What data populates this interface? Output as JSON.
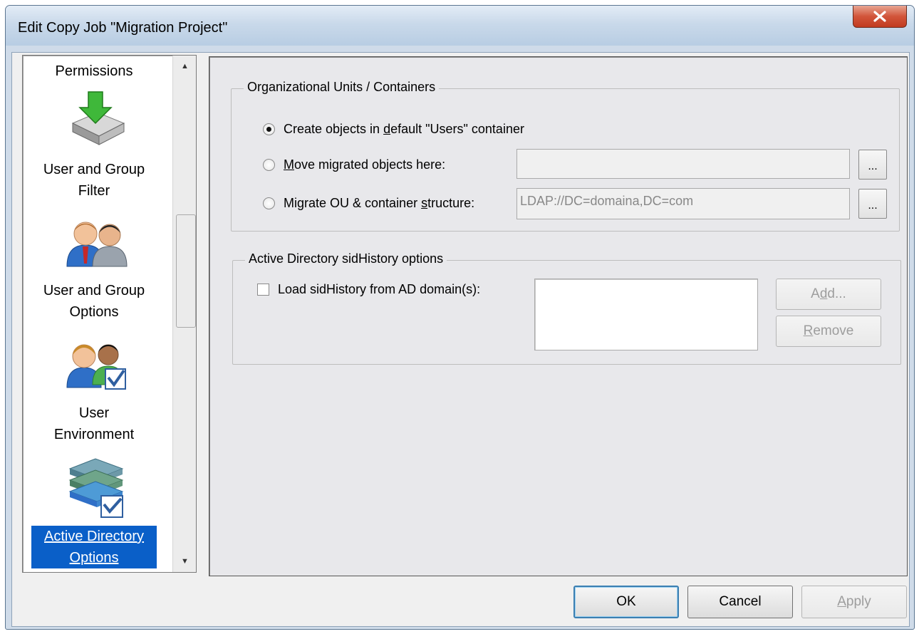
{
  "window": {
    "title": "Edit Copy Job \"Migration Project\""
  },
  "sidebar": {
    "items": [
      {
        "label": "Permissions",
        "icon": "permissions-download-icon"
      },
      {
        "label_line1": "User and Group",
        "label_line2": "Filter",
        "icon": "users-filter-icon"
      },
      {
        "label_line1": "User and Group",
        "label_line2": "Options",
        "icon": "users-options-icon"
      },
      {
        "label_line1": "User",
        "label_line2": "Environment",
        "icon": "user-environment-icon"
      },
      {
        "label_line1": "Active Directory",
        "label_line2": "Options",
        "icon": "active-directory-icon",
        "selected": true
      }
    ]
  },
  "ou_group": {
    "legend": "Organizational Units / Containers",
    "option_default": {
      "pre": "Create objects in ",
      "u": "d",
      "post": "efault \"Users\" container",
      "checked": true
    },
    "option_move": {
      "pre": "",
      "u": "M",
      "post": "ove migrated objects here:",
      "value": ""
    },
    "option_migrate": {
      "pre": "Migrate OU & container ",
      "u": "s",
      "post": "tructure:",
      "value": "LDAP://DC=domaina,DC=com"
    },
    "browse_label": "..."
  },
  "sid_group": {
    "legend": "Active Directory sidHistory options",
    "checkbox_label": "Load sidHistory from AD domain(s):",
    "add": {
      "pre": "A",
      "u": "d",
      "post": "d..."
    },
    "remove": {
      "pre": "",
      "u": "R",
      "post": "emove"
    }
  },
  "footer": {
    "ok": "OK",
    "cancel": "Cancel",
    "apply": {
      "pre": "",
      "u": "A",
      "post": "pply"
    }
  },
  "colors": {
    "selection": "#0a5fc8",
    "close": "#c13b20",
    "panel": "#e8e8eb"
  }
}
